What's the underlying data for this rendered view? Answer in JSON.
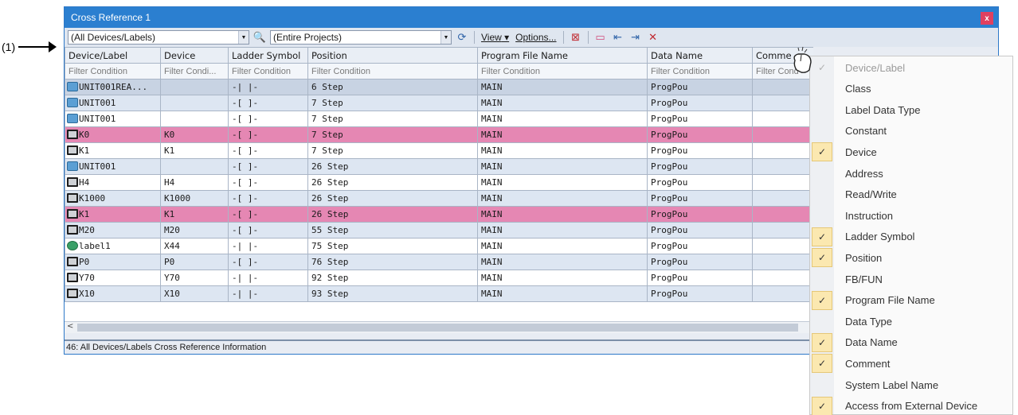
{
  "callout": {
    "label": "(1)"
  },
  "window": {
    "title": "Cross Reference 1",
    "close": "x"
  },
  "toolbar": {
    "device_combo": "(All Devices/Labels)",
    "project_combo": "(Entire Projects)",
    "view_label": "View",
    "options_label": "Options..."
  },
  "grid": {
    "columns": [
      "Device/Label",
      "Device",
      "Ladder Symbol",
      "Position",
      "Program File Name",
      "Data Name",
      "Comme"
    ],
    "filters": [
      "Filter Condition",
      "Filter Condi...",
      "Filter Condition",
      "Filter Condition",
      "Filter Condition",
      "Filter Condition",
      "Filter Cond"
    ],
    "rows": [
      {
        "icon": "label-icon",
        "style": "sel",
        "cells": [
          "UNIT001REA...",
          "",
          "-| |-",
          "6 Step",
          "MAIN",
          "ProgPou",
          ""
        ]
      },
      {
        "icon": "label-icon",
        "style": "",
        "cells": [
          "UNIT001",
          "",
          "-[ ]-",
          "7 Step",
          "MAIN",
          "ProgPou",
          ""
        ]
      },
      {
        "icon": "label-icon",
        "style": "white",
        "cells": [
          "UNIT001",
          "",
          "-[ ]-",
          "7 Step",
          "MAIN",
          "ProgPou",
          ""
        ]
      },
      {
        "icon": "device-icon",
        "style": "hl",
        "cells": [
          "K0",
          "K0",
          "-[ ]-",
          "7 Step",
          "MAIN",
          "ProgPou",
          ""
        ]
      },
      {
        "icon": "device-icon",
        "style": "white",
        "cells": [
          "K1",
          "K1",
          "-[ ]-",
          "7 Step",
          "MAIN",
          "ProgPou",
          ""
        ]
      },
      {
        "icon": "label-icon",
        "style": "",
        "cells": [
          "UNIT001",
          "",
          "-[ ]-",
          "26 Step",
          "MAIN",
          "ProgPou",
          ""
        ]
      },
      {
        "icon": "device-icon",
        "style": "white",
        "cells": [
          "H4",
          "H4",
          "-[ ]-",
          "26 Step",
          "MAIN",
          "ProgPou",
          ""
        ]
      },
      {
        "icon": "device-icon",
        "style": "",
        "cells": [
          "K1000",
          "K1000",
          "-[ ]-",
          "26 Step",
          "MAIN",
          "ProgPou",
          ""
        ]
      },
      {
        "icon": "device-icon",
        "style": "hl",
        "cells": [
          "K1",
          "K1",
          "-[ ]-",
          "26 Step",
          "MAIN",
          "ProgPou",
          ""
        ]
      },
      {
        "icon": "device-icon",
        "style": "",
        "cells": [
          "M20",
          "M20",
          "-[ ]-",
          "55 Step",
          "MAIN",
          "ProgPou",
          ""
        ]
      },
      {
        "icon": "global-label-icon",
        "style": "white",
        "cells": [
          "label1",
          "X44",
          "-| |-",
          "75 Step",
          "MAIN",
          "ProgPou",
          ""
        ]
      },
      {
        "icon": "device-icon",
        "style": "",
        "cells": [
          "P0",
          "P0",
          "-[ ]-",
          "76 Step",
          "MAIN",
          "ProgPou",
          ""
        ]
      },
      {
        "icon": "device-icon",
        "style": "white",
        "cells": [
          "Y70",
          "Y70",
          "-| |-",
          "92 Step",
          "MAIN",
          "ProgPou",
          ""
        ]
      },
      {
        "icon": "device-icon",
        "style": "",
        "cells": [
          "X10",
          "X10",
          "-| |-",
          "93 Step",
          "MAIN",
          "ProgPou",
          ""
        ]
      }
    ]
  },
  "status": {
    "text": "46: All Devices/Labels Cross Reference Information"
  },
  "menu": {
    "items": [
      {
        "label": "Device/Label",
        "checked": true,
        "disabled": true
      },
      {
        "label": "Class",
        "checked": false
      },
      {
        "label": "Label Data Type",
        "checked": false
      },
      {
        "label": "Constant",
        "checked": false
      },
      {
        "label": "Device",
        "checked": true
      },
      {
        "label": "Address",
        "checked": false
      },
      {
        "label": "Read/Write",
        "checked": false
      },
      {
        "label": "Instruction",
        "checked": false
      },
      {
        "label": "Ladder Symbol",
        "checked": true
      },
      {
        "label": "Position",
        "checked": true
      },
      {
        "label": "FB/FUN",
        "checked": false
      },
      {
        "label": "Program File Name",
        "checked": true
      },
      {
        "label": "Data Type",
        "checked": false
      },
      {
        "label": "Data Name",
        "checked": true
      },
      {
        "label": "Comment",
        "checked": true
      },
      {
        "label": "System Label Name",
        "checked": false
      },
      {
        "label": "Access from External Device",
        "checked": true
      }
    ]
  }
}
